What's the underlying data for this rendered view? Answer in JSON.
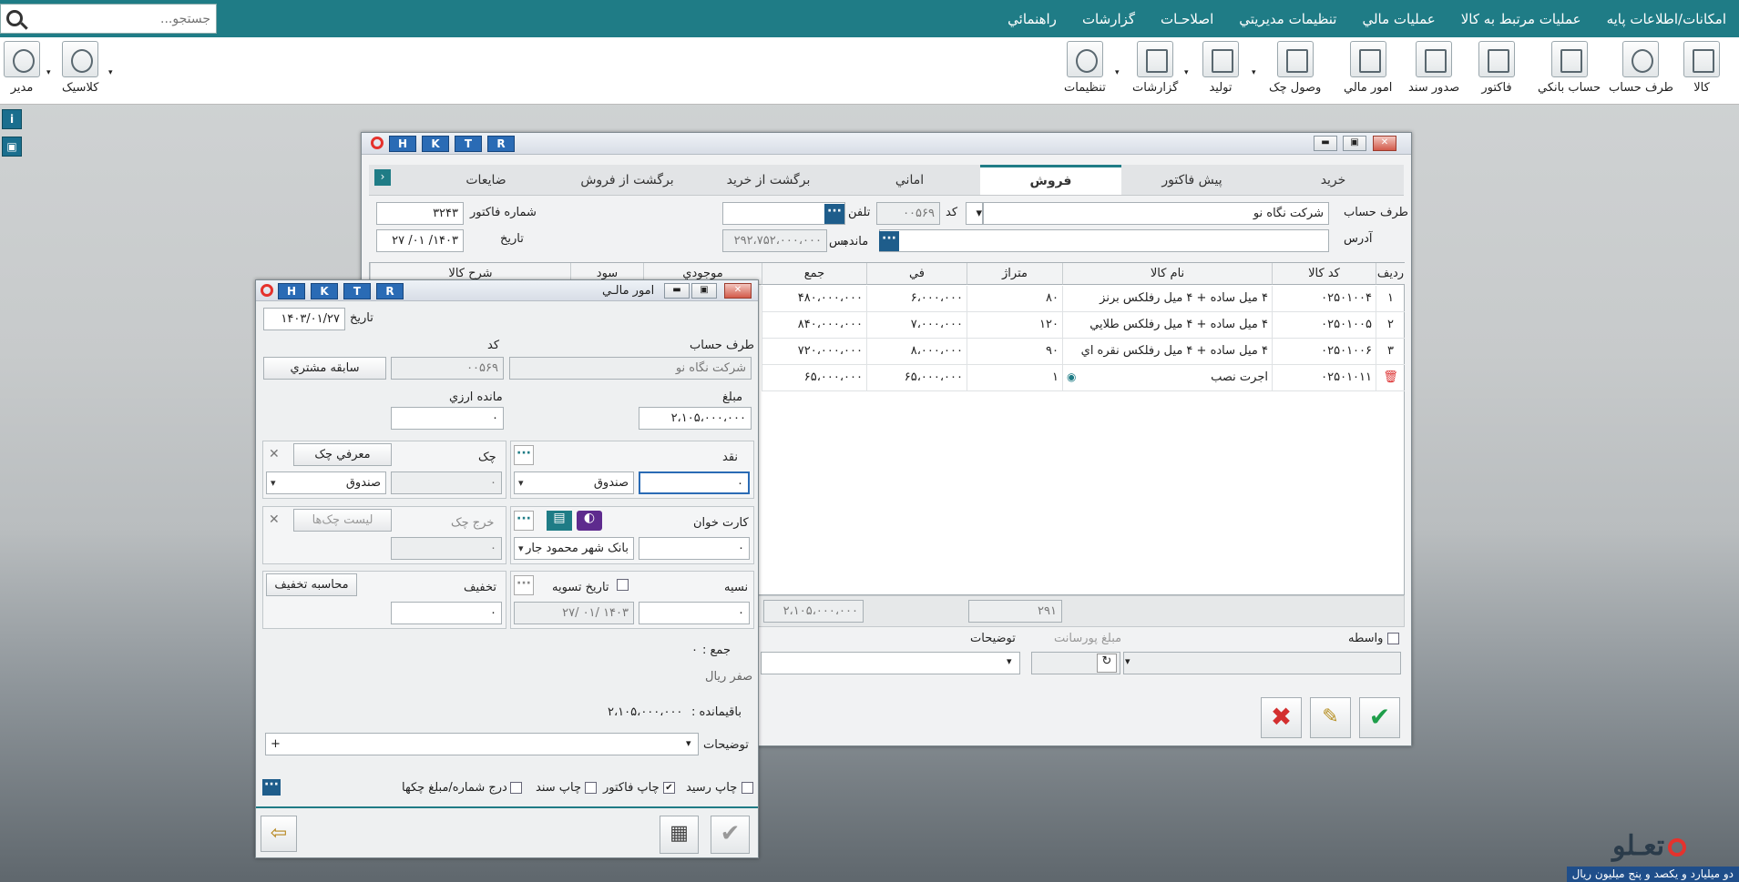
{
  "search": {
    "placeholder": "جستجو..."
  },
  "menu": [
    "امکانات/اطلاعات پايه",
    "عمليات مرتبط به کالا",
    "عمليات مالي",
    "تنظيمات مديريتي",
    "اصلاحـات",
    "گزارشات",
    "راهنمائي"
  ],
  "toolbar": [
    "کالا",
    "طرف حساب",
    "حساب بانکي",
    "فاکتور",
    "صدور سند",
    "امور مالي",
    "وصول چک",
    "توليد",
    "گزارشات",
    "تنظيمات"
  ],
  "toolbar_left": [
    "کلاسيک",
    "مدير"
  ],
  "main": {
    "hk": [
      "H",
      "K",
      "T",
      "R"
    ],
    "tabs": [
      "خريد",
      "پيش فاکتور",
      "فروش",
      "اماني",
      "برگشت از خريد",
      "برگشت از فروش",
      "ضايعات"
    ],
    "labels": {
      "party": "طرف حساب",
      "code": "کد",
      "phone": "تلفن",
      "invoice_no": "شماره فاکتور",
      "address": "آدرس",
      "remain": "مانده",
      "bes": "بس",
      "date": "تاريخ",
      "notes": "توضيحات",
      "broker": "واسطه",
      "commission": "مبلغ پورسانت"
    },
    "values": {
      "party": "شرکت نگاه نو",
      "code": "۰۰۵۶۹",
      "invoice_no": "۳۲۴۳",
      "date": "۱۴۰۳/ ۰۱/ ۲۷",
      "remain": "۲۹۲،۷۵۲،۰۰۰،۰۰۰"
    },
    "columns": [
      "رديف",
      "کد کالا",
      "نام کالا",
      "متراژ",
      "في",
      "جمع",
      "موجودي",
      "سود",
      "شرح کالا"
    ],
    "rows": [
      {
        "n": "۱",
        "code": "۰۲۵۰۱۰۰۴",
        "name": "۴ ميل ساده + ۴ ميل رفلکس برنز",
        "qty": "۸۰",
        "price": "۶،۰۰۰،۰۰۰",
        "total": "۴۸۰،۰۰۰،۰۰۰"
      },
      {
        "n": "۲",
        "code": "۰۲۵۰۱۰۰۵",
        "name": "۴ ميل ساده + ۴ ميل رفلکس طلايي",
        "qty": "۱۲۰",
        "price": "۷،۰۰۰،۰۰۰",
        "total": "۸۴۰،۰۰۰،۰۰۰"
      },
      {
        "n": "۳",
        "code": "۰۲۵۰۱۰۰۶",
        "name": "۴ ميل ساده + ۴ ميل رفلکس نقره اي",
        "qty": "۹۰",
        "price": "۸،۰۰۰،۰۰۰",
        "total": "۷۲۰،۰۰۰،۰۰۰"
      },
      {
        "n": "",
        "code": "۰۲۵۰۱۰۱۱",
        "name": "اجرت نصب",
        "qty": "۱",
        "price": "۶۵،۰۰۰،۰۰۰",
        "total": "۶۵،۰۰۰،۰۰۰"
      }
    ],
    "footer": {
      "qty_sum": "۲۹۱",
      "total_sum": "۲،۱۰۵،۰۰۰،۰۰۰"
    }
  },
  "fin": {
    "hk": [
      "H",
      "K",
      "T",
      "R"
    ],
    "title": "امور مالـي",
    "date_label": "تاريخ",
    "date": "۱۴۰۳/۰۱/۲۷",
    "party_label": "طرف حساب",
    "party": "شرکت نگاه نو",
    "code_label": "کد",
    "code": "۰۰۵۶۹",
    "history_btn": "سابقه مشتري",
    "amount_label": "مبلغ",
    "amount": "۲،۱۰۵،۰۰۰،۰۰۰",
    "fx_label": "مانده ارزي",
    "fx": "۰",
    "cash_label": "نقد",
    "cash": "۰",
    "cash_box": "صندوق",
    "cheque_label": "چک",
    "cheque_btn": "معرفي چک",
    "cheque": "۰",
    "cheque_box": "صندوق",
    "card_label": "کارت خوان",
    "card": "۰",
    "card_bank": "بانک شهر محمود جار",
    "cheque_out_label": "خرج چک",
    "cheque_list_btn": "ليست چک‌ها",
    "cheque_out": "۰",
    "credit_label": "نسيه",
    "credit": "۰",
    "settle_label": "تاريخ تسويه",
    "settle_date": "۱۴۰۳   /۰۱   /۲۷",
    "discount_label": "تخفيف",
    "discount_btn": "محاسبه تخفيف",
    "discount": "۰",
    "sum_label": "جمع :",
    "sum": "۰",
    "sum_words": "صفر ريال",
    "remaining_label": "باقيمانده :",
    "remaining": "۲،۱۰۵،۰۰۰،۰۰۰",
    "notes_label": "توضيحات",
    "notes": "+",
    "print_receipt": "چاپ رسيد",
    "print_invoice": "چاپ فاکتور",
    "print_doc": "چاپ سند",
    "print_cheques": "درج شماره/مبلغ چکها"
  },
  "brand": "تعـلو",
  "status": "دو ميليارد و يکصد و پنج ميليون ريال"
}
